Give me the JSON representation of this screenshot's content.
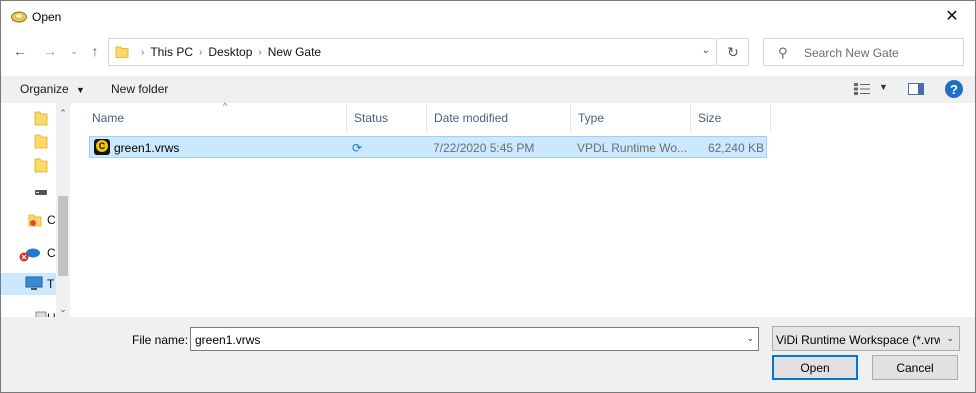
{
  "window": {
    "title": "Open",
    "close_icon": "close-icon",
    "title_icon": "disc-icon"
  },
  "address": {
    "breadcrumbs": [
      "This PC",
      "Desktop",
      "New Gate"
    ]
  },
  "search": {
    "placeholder": "Search New Gate"
  },
  "toolbar": {
    "organize_label": "Organize",
    "new_folder_label": "New folder"
  },
  "nav_pane": {
    "items": [
      {
        "icon": "folder-icon",
        "label": ""
      },
      {
        "icon": "folder-icon",
        "label": ""
      },
      {
        "icon": "folder-icon",
        "label": ""
      },
      {
        "icon": "drive-icon",
        "label": ""
      },
      {
        "icon": "creative-cloud-icon",
        "label": "C"
      },
      {
        "icon": "onedrive-icon",
        "label": "C"
      },
      {
        "icon": "this-pc-icon",
        "label": "T"
      },
      {
        "icon": "network-icon",
        "label": "U"
      }
    ]
  },
  "columns": {
    "name": "Name",
    "status": "Status",
    "date": "Date modified",
    "type": "Type",
    "size": "Size"
  },
  "files": [
    {
      "name": "green1.vrws",
      "status_icon": "sync-icon",
      "date": "7/22/2020 5:45 PM",
      "type": "VPDL Runtime Wo...",
      "size": "62,240 KB"
    }
  ],
  "bottom": {
    "file_name_label": "File name:",
    "file_name_value": "green1.vrws",
    "filter_value": "ViDi Runtime Workspace (*.vrw",
    "open_label": "Open",
    "cancel_label": "Cancel"
  },
  "colors": {
    "selection": "#cce8ff",
    "selection_border": "#99d1ff",
    "accent": "#0078d7",
    "chrome": "#f0f0f0"
  }
}
